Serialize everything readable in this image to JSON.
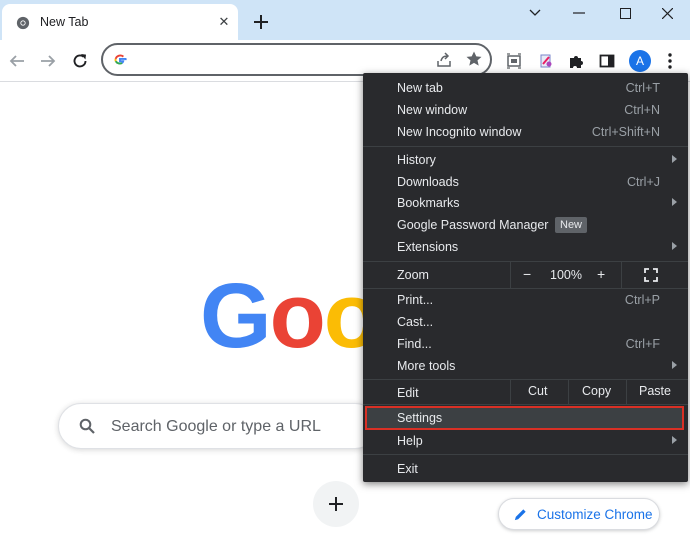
{
  "tab": {
    "title": "New Tab",
    "close": "✕",
    "new_tab": "+"
  },
  "window": {
    "minimize": "⌄",
    "maximize": "☐",
    "close": "✕"
  },
  "toolbar": {
    "back": "←",
    "forward": "→",
    "reload": "↻",
    "avatar_letter": "A",
    "omnibox_placeholder": ""
  },
  "ntp": {
    "logo_letters": [
      "G",
      "o",
      "o"
    ],
    "search_placeholder": "Search Google or type a URL",
    "customize_label": "Customize Chrome"
  },
  "menu": {
    "new_tab": {
      "label": "New tab",
      "shortcut": "Ctrl+T"
    },
    "new_window": {
      "label": "New window",
      "shortcut": "Ctrl+N"
    },
    "new_incognito": {
      "label": "New Incognito window",
      "shortcut": "Ctrl+Shift+N"
    },
    "history": {
      "label": "History"
    },
    "downloads": {
      "label": "Downloads",
      "shortcut": "Ctrl+J"
    },
    "bookmarks": {
      "label": "Bookmarks"
    },
    "password_manager": {
      "label": "Google Password Manager",
      "badge": "New"
    },
    "extensions": {
      "label": "Extensions"
    },
    "zoom": {
      "label": "Zoom",
      "minus": "−",
      "level": "100%",
      "plus": "+"
    },
    "print": {
      "label": "Print...",
      "shortcut": "Ctrl+P"
    },
    "cast": {
      "label": "Cast..."
    },
    "find": {
      "label": "Find...",
      "shortcut": "Ctrl+F"
    },
    "more_tools": {
      "label": "More tools"
    },
    "edit": {
      "label": "Edit",
      "cut": "Cut",
      "copy": "Copy",
      "paste": "Paste"
    },
    "settings": {
      "label": "Settings"
    },
    "help": {
      "label": "Help"
    },
    "exit": {
      "label": "Exit"
    }
  },
  "colors": {
    "tabstrip": "#cfe4f7",
    "menu_bg": "#292a2d",
    "highlight_border": "#d93025",
    "google_blue": "#4285f4",
    "google_red": "#ea4335",
    "google_yellow": "#fbbc05"
  }
}
